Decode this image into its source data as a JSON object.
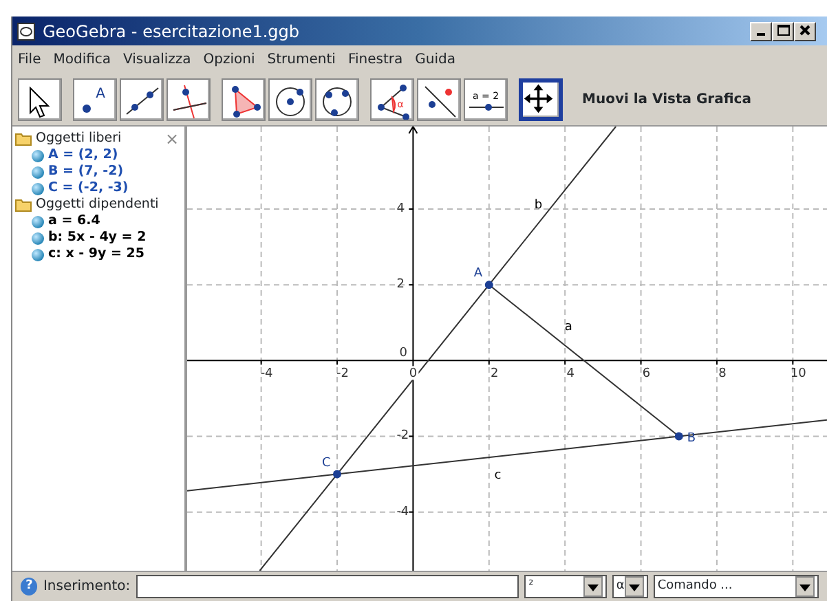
{
  "window": {
    "title": "GeoGebra - esercitazione1.ggb"
  },
  "menu": [
    "File",
    "Modifica",
    "Visualizza",
    "Opzioni",
    "Strumenti",
    "Finestra",
    "Guida"
  ],
  "toolbar": {
    "tools": [
      {
        "kind": "pointer",
        "selected": false
      },
      {
        "kind": "point",
        "label": "A",
        "selected": false
      },
      {
        "kind": "line",
        "selected": false
      },
      {
        "kind": "perpendicular",
        "selected": false
      },
      {
        "kind": "polygon",
        "selected": false
      },
      {
        "kind": "circle",
        "selected": false
      },
      {
        "kind": "conic",
        "selected": false
      },
      {
        "kind": "angle",
        "label": "α",
        "selected": false
      },
      {
        "kind": "reflect",
        "selected": false
      },
      {
        "kind": "slider",
        "label": "a = 2",
        "selected": false
      },
      {
        "kind": "move",
        "selected": true
      }
    ],
    "tool_name": "Muovi la Vista Grafica"
  },
  "algebra": {
    "close": "×",
    "groups": [
      {
        "label": "Oggetti liberi",
        "children": [
          {
            "label": "A = (2, 2)",
            "color": "#1f4fb0"
          },
          {
            "label": "B = (7, -2)",
            "color": "#1f4fb0"
          },
          {
            "label": "C = (-2, -3)",
            "color": "#1f4fb0"
          }
        ]
      },
      {
        "label": "Oggetti dipendenti",
        "children": [
          {
            "label": "a = 6.4",
            "color": "#000000"
          },
          {
            "label": "b: 5x - 4y = 2",
            "color": "#000000"
          },
          {
            "label": "c: x - 9y = 25",
            "color": "#000000"
          }
        ]
      }
    ]
  },
  "graphics": {
    "chart_data": {
      "type": "scatter",
      "x": [
        2,
        7,
        -2,
        -4.04,
        5.34,
        -5.95,
        10.9
      ],
      "xlim": [
        -5.95,
        10.9
      ],
      "ylim": [
        -5.55,
        6.18
      ],
      "grid": true,
      "xticks": [
        -4,
        -2,
        {
          "value": 0,
          "label": "0"
        },
        2,
        4,
        6,
        8,
        10
      ],
      "yticks": [
        -4,
        -2,
        {
          "value": 0,
          "label": "0"
        },
        2,
        4
      ],
      "series": [
        {
          "name": "A",
          "type": "scatter",
          "color": "#1c3f94",
          "values": [
            2,
            null,
            null,
            null,
            null,
            null,
            null
          ]
        },
        {
          "name": "B",
          "type": "scatter",
          "color": "#1c3f94",
          "values": [
            null,
            -2,
            null,
            null,
            null,
            null,
            null
          ]
        },
        {
          "name": "C",
          "type": "scatter",
          "color": "#1c3f94",
          "values": [
            null,
            null,
            -3,
            null,
            null,
            null,
            null
          ]
        },
        {
          "name": "a",
          "type": "line",
          "color": "#333333",
          "values": [
            2,
            -2,
            null,
            null,
            null,
            null,
            null
          ]
        },
        {
          "name": "b",
          "type": "line",
          "color": "#333333",
          "values": [
            2,
            null,
            -3,
            -5.55,
            6.18,
            null,
            null
          ]
        },
        {
          "name": "c",
          "type": "line",
          "color": "#333333",
          "values": [
            null,
            -2,
            -3,
            null,
            null,
            -3.44,
            -1.57
          ]
        }
      ]
    }
  },
  "input_bar": {
    "help": "?",
    "label": "Inserimento:",
    "symbol": "²",
    "greek": "α",
    "command": "Comando ..."
  }
}
